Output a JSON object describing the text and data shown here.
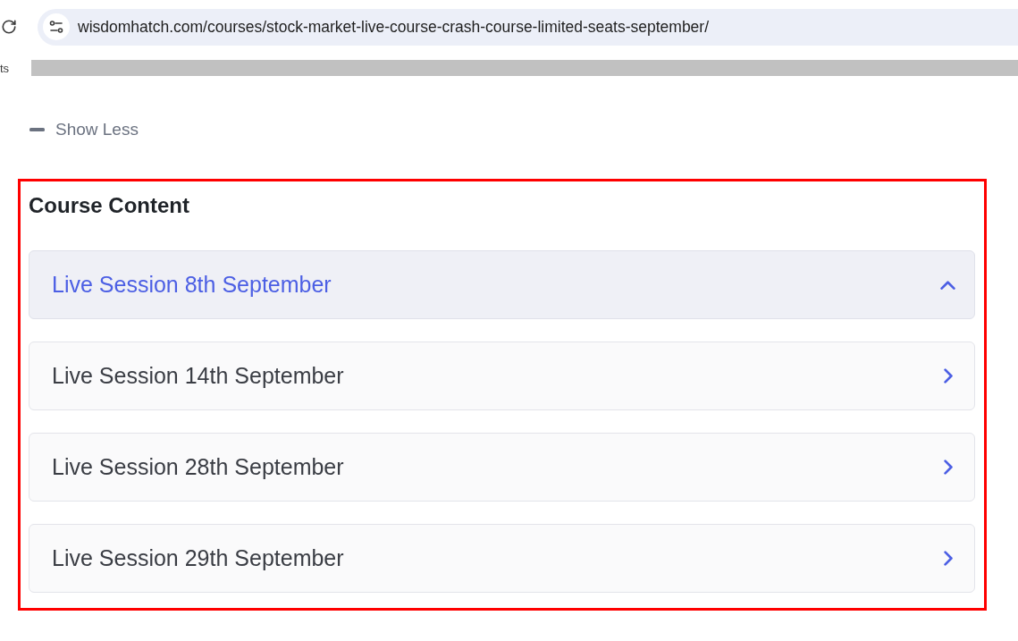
{
  "browser": {
    "url": "wisdomhatch.com/courses/stock-market-live-course-crash-course-limited-seats-september/",
    "bookmark_fragment": "ts"
  },
  "toggle": {
    "label": "Show Less",
    "expanded": true
  },
  "course_content": {
    "title": "Course Content",
    "sections": [
      {
        "title": "Live Session 8th September",
        "expanded": true
      },
      {
        "title": "Live Session 14th September",
        "expanded": false
      },
      {
        "title": "Live Session 28th September",
        "expanded": false
      },
      {
        "title": "Live Session 29th September",
        "expanded": false
      }
    ]
  }
}
